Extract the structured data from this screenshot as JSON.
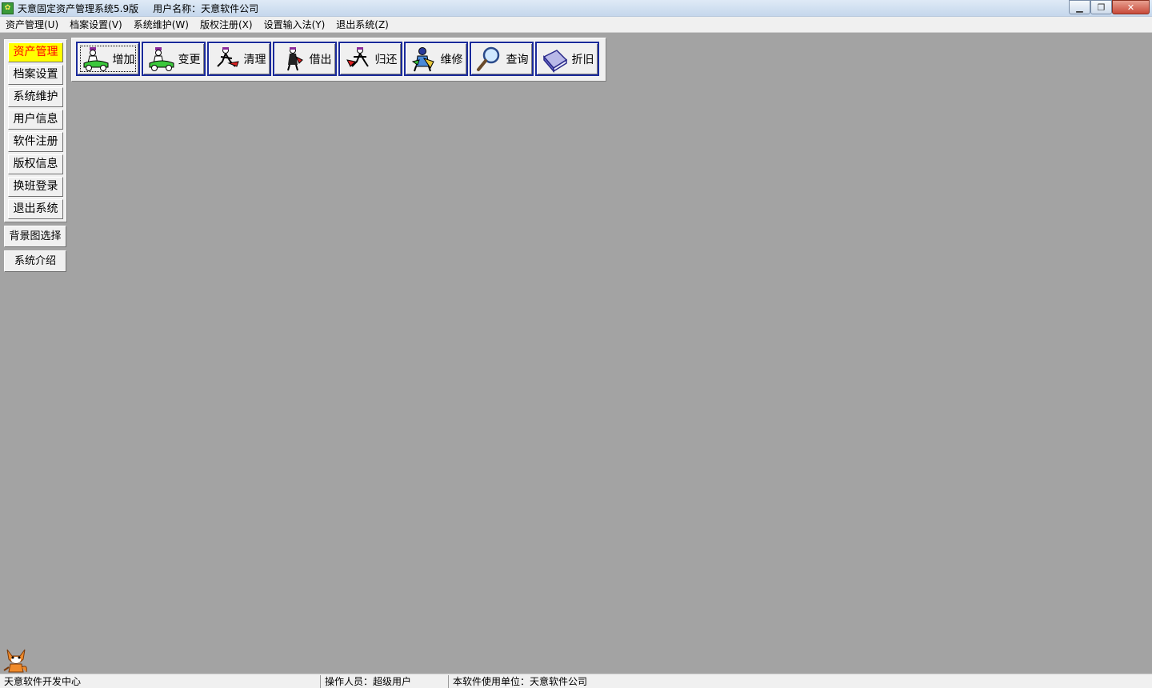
{
  "window": {
    "title": "天意固定资产管理系统5.9版",
    "user_label": "用户名称：天意软件公司",
    "icon": "app-logo-icon",
    "controls": {
      "minimize": "minimize-icon",
      "maximize": "restore-icon",
      "close": "close-icon"
    }
  },
  "menu": [
    {
      "label": "资产管理(U)"
    },
    {
      "label": "档案设置(V)"
    },
    {
      "label": "系统维护(W)"
    },
    {
      "label": "版权注册(X)"
    },
    {
      "label": "设置输入法(Y)"
    },
    {
      "label": "退出系统(Z)"
    }
  ],
  "sidebar": {
    "items": [
      {
        "label": "资产管理",
        "active": true
      },
      {
        "label": "档案设置"
      },
      {
        "label": "系统维护"
      },
      {
        "label": "用户信息"
      },
      {
        "label": "软件注册"
      },
      {
        "label": "版权信息"
      },
      {
        "label": "换班登录"
      },
      {
        "label": "退出系统"
      }
    ],
    "extra": [
      {
        "label": "背景图选择"
      },
      {
        "label": "系统介绍"
      }
    ],
    "active_bg": "#ffff00",
    "active_fg": "#ff0000"
  },
  "toolbar": {
    "buttons": [
      {
        "label": "增加",
        "icon": "car-person-add-icon"
      },
      {
        "label": "变更",
        "icon": "car-person-change-icon"
      },
      {
        "label": "清理",
        "icon": "person-clean-icon"
      },
      {
        "label": "借出",
        "icon": "person-lend-icon"
      },
      {
        "label": "归还",
        "icon": "person-return-icon"
      },
      {
        "label": "维修",
        "icon": "repair-person-icon"
      },
      {
        "label": "查询",
        "icon": "magnifier-icon"
      },
      {
        "label": "折旧",
        "icon": "book-icon"
      }
    ],
    "border_color": "#1a2a9a"
  },
  "status": {
    "developer": "天意软件开发中心",
    "operator": "操作人员：超级用户",
    "unit": "本软件使用单位：天意软件公司"
  },
  "colors": {
    "workspace_bg": "#a3a3a3",
    "panel_bg": "#f0f0f0"
  }
}
